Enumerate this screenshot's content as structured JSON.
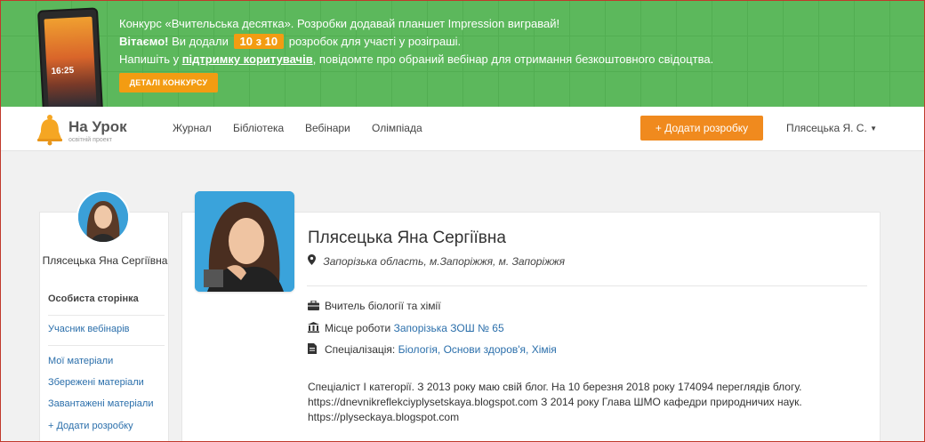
{
  "promo": {
    "line1": "Конкурс «Вчительська десятка». Розробки додавай планшет Impression вигравай!",
    "greeting": "Вітаємо!",
    "added_prefix": "Ви додали",
    "count_badge": "10 з 10",
    "added_suffix": "розробок для участі у розіграші.",
    "write_prefix": "Напишіть у",
    "support_link": "підтримку коритувачів",
    "write_suffix": ", повідомте про обраний вебінар для отримання безкоштовного свідоцтва.",
    "details_button": "ДЕТАЛІ КОНКУРСУ",
    "tablet_clock": "16:25"
  },
  "navbar": {
    "logo_title": "На Урок",
    "logo_subtitle": "освітній проект",
    "links": [
      "Журнал",
      "Бібліотека",
      "Вебінари",
      "Олімпіада"
    ],
    "add_button": "+ Додати розробку",
    "user": "Плясецька Я. С."
  },
  "sidebar": {
    "name": "Плясецька Яна Сергіївна",
    "personal_page": "Особиста сторінка",
    "webinar_participant": "Учасник вебінарів",
    "my_materials": "Мої матеріали",
    "saved_materials": "Збережені матеріали",
    "downloaded_materials": "Завантажені матеріали",
    "add_material": "+ Додати розробку"
  },
  "profile": {
    "name": "Плясецька Яна Сергіївна",
    "location": "Запорізька область, м.Запоріжжя, м. Запоріжжя",
    "position": "Вчитель біології та хімії",
    "workplace_label": "Місце роботи",
    "workplace": "Запорізька ЗОШ № 65",
    "specialization_label": "Спеціалізація:",
    "specializations": "Біологія, Основи здоров'я, Хімія",
    "bio_line1": "Спеціаліст І категорії. З 2013 року маю свій блог. На 10 березня 2018 року 174094 переглядів блогу.",
    "bio_line2": "https://dnevnikreflekciyplysetskaya.blogspot.com З 2014 року Глава ШМО кафедри природничих наук.",
    "bio_line3": "https://plyseckaya.blogspot.com"
  },
  "colors": {
    "promo_green": "#5cb85c",
    "accent_orange": "#f08a1e",
    "link_blue": "#2b6fab"
  }
}
